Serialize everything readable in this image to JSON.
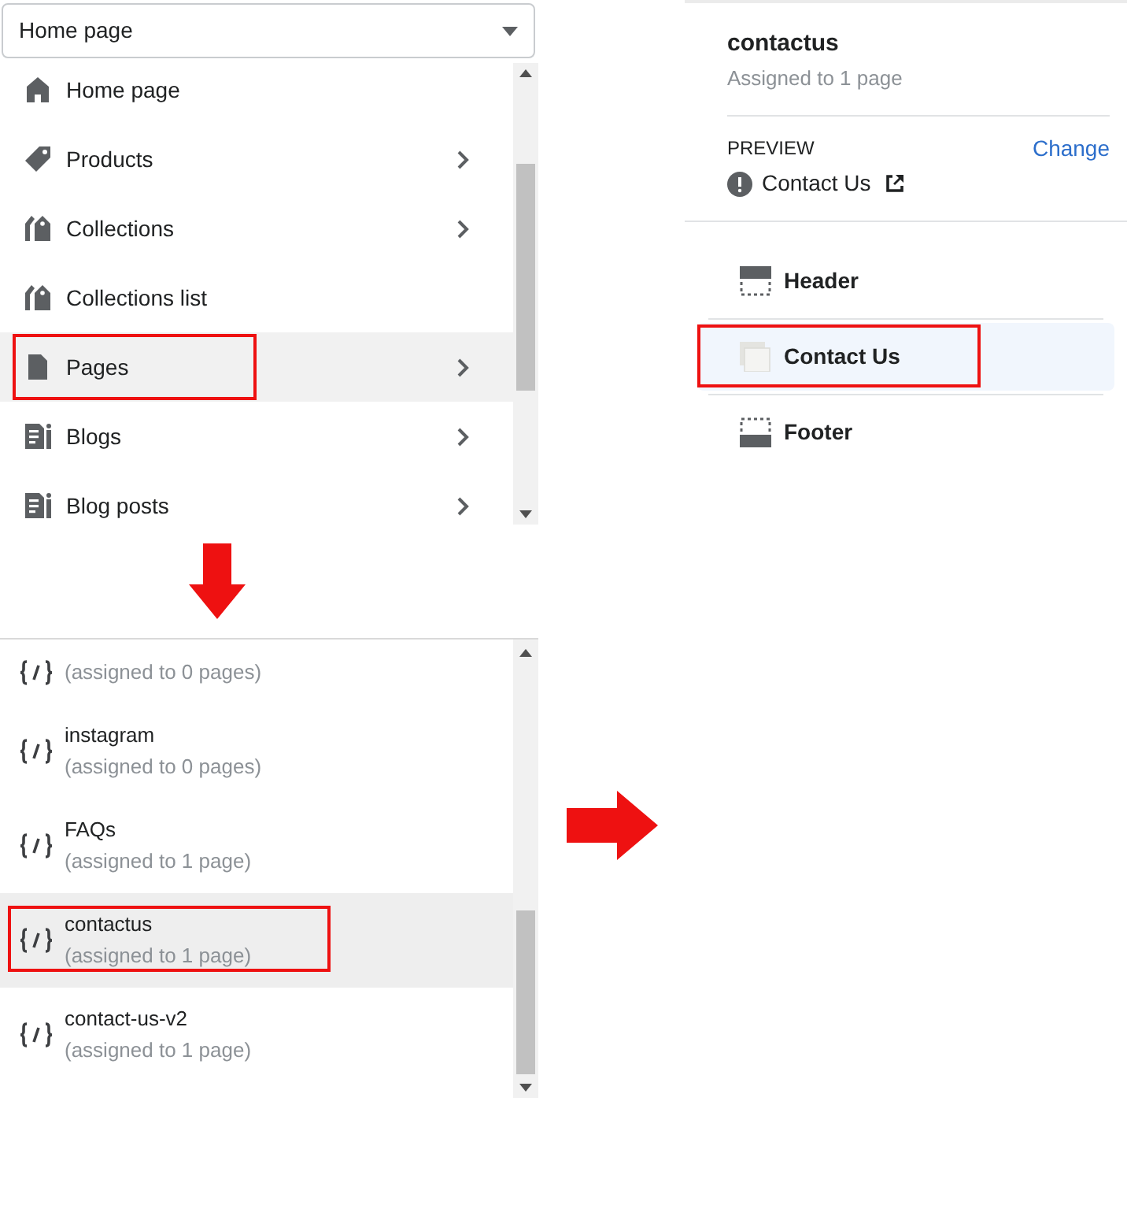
{
  "template_select": {
    "value": "Home page"
  },
  "menu": {
    "items": [
      {
        "label": "Home page",
        "kind": "home",
        "has_submenu": false,
        "selected": false,
        "outlined": false
      },
      {
        "label": "Products",
        "kind": "tag",
        "has_submenu": true,
        "selected": false,
        "outlined": false
      },
      {
        "label": "Collections",
        "kind": "tags",
        "has_submenu": true,
        "selected": false,
        "outlined": false
      },
      {
        "label": "Collections list",
        "kind": "tags",
        "has_submenu": false,
        "selected": false,
        "outlined": false
      },
      {
        "label": "Pages",
        "kind": "page",
        "has_submenu": true,
        "selected": true,
        "outlined": true
      },
      {
        "label": "Blogs",
        "kind": "blog",
        "has_submenu": true,
        "selected": false,
        "outlined": false
      },
      {
        "label": "Blog posts",
        "kind": "blog",
        "has_submenu": true,
        "selected": false,
        "outlined": false
      }
    ]
  },
  "templates": {
    "items": [
      {
        "subtitle": "(assigned to 0 pages)",
        "selected": false,
        "outlined": false
      },
      {
        "name": "instagram",
        "subtitle": "(assigned to 0 pages)",
        "selected": false,
        "outlined": false
      },
      {
        "name": "FAQs",
        "subtitle": "(assigned to 1 page)",
        "selected": false,
        "outlined": false
      },
      {
        "name": "contactus",
        "subtitle": "(assigned to 1 page)",
        "selected": true,
        "outlined": true
      },
      {
        "name": "contact-us-v2",
        "subtitle": "(assigned to 1 page)",
        "selected": false,
        "outlined": false
      }
    ]
  },
  "template_panel": {
    "title": "contactus",
    "subtitle": "Assigned to 1 page",
    "preview_label": "PREVIEW",
    "change_link": "Change",
    "preview_page": "Contact Us",
    "sections": [
      {
        "label": "Header",
        "kind": "header",
        "selected": false,
        "outlined": false
      },
      {
        "label": "Contact Us",
        "kind": "section",
        "selected": true,
        "outlined": true
      },
      {
        "label": "Footer",
        "kind": "footer",
        "selected": false,
        "outlined": false
      }
    ]
  }
}
